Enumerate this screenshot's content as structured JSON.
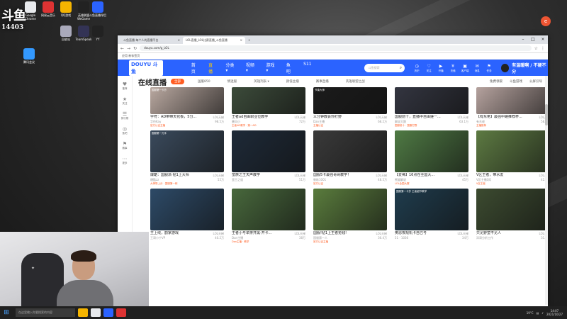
{
  "stream": {
    "logo_top": "斗鱼",
    "room_id": "14403"
  },
  "desktop_icons": [
    {
      "label": "Google Chrome",
      "color": "#e8eaed"
    },
    {
      "label": "网易云音乐",
      "color": "#d33"
    },
    {
      "label": "QQ游戏",
      "color": "#f4b400"
    },
    {
      "label": "英雄联盟 WeGame",
      "color": "#222"
    },
    {
      "label": "斗鱼直播伴侣",
      "color": "#2b63ff"
    },
    {
      "label": "回收站",
      "color": "#aab"
    },
    {
      "label": "TeamSpeak",
      "color": "#335"
    },
    {
      "label": "YY",
      "color": "#222"
    },
    {
      "label": "腾讯会议",
      "color": "#39f"
    }
  ],
  "browser": {
    "tabs": [
      {
        "label": "斗鱼直播-每个人的直播平台",
        "active": false
      },
      {
        "label": "LOL直播_LOL比赛直播_斗鱼直播",
        "active": true
      }
    ],
    "new_tab": "+",
    "url": "douyu.com/g_LOL",
    "bookmarks": "应用  新标签页"
  },
  "douyu": {
    "logo": "DOUYU 斗鱼",
    "nav": [
      {
        "label": "首页",
        "active": false
      },
      {
        "label": "直播",
        "active": true
      },
      {
        "label": "分类 ▾",
        "active": false
      },
      {
        "label": "视频 ▾",
        "active": false
      },
      {
        "label": "游戏 ▾",
        "active": false
      },
      {
        "label": "鱼吧",
        "active": false
      },
      {
        "label": "S11",
        "active": false
      }
    ],
    "search_placeholder": "斗鱼搜索",
    "header_icons": [
      {
        "label": "历史",
        "glyph": "◷"
      },
      {
        "label": "关注",
        "glyph": "♡"
      },
      {
        "label": "开播",
        "glyph": "▶"
      },
      {
        "label": "充值",
        "glyph": "¥"
      },
      {
        "label": "客户端",
        "glyph": "▣"
      },
      {
        "label": "消息",
        "glyph": "✉"
      },
      {
        "label": "任务",
        "glyph": "⚑"
      }
    ],
    "username": "有温暖啊 / 不硬不分",
    "left_rail": [
      {
        "label": "推荐",
        "glyph": "♥"
      },
      {
        "label": "关注",
        "glyph": "★"
      },
      {
        "label": "排行榜",
        "glyph": "☰"
      },
      {
        "label": "鱼吧",
        "glyph": "◎"
      },
      {
        "label": "赛事",
        "glyph": "⚑"
      },
      {
        "label": "更多",
        "glyph": "⋯"
      }
    ],
    "section_title": "在线直播",
    "filters": [
      {
        "label": "全部",
        "active": true
      },
      {
        "label": "国服850",
        "active": false
      },
      {
        "label": "情迷服",
        "active": false
      },
      {
        "label": "英雄列表 ▾",
        "active": false
      },
      {
        "label": "颜值主播",
        "active": false
      },
      {
        "label": "赛事直播",
        "active": false
      },
      {
        "label": "英雄联盟之战",
        "active": false
      }
    ],
    "header_right": [
      "免费领取",
      "斗鱼游戏",
      "公屏引导"
    ],
    "cards": [
      {
        "title": "字符：AD带带天花板，5分...",
        "cat": "LOL天梯",
        "anchor": "字符Kay",
        "hot": "98.5万",
        "badge": "官方认证主播",
        "color": "#b9a8a0",
        "tag": "国服第一卡莎",
        "cut": true
      },
      {
        "title": "王者ad自由职业位教学",
        "cat": "LOL天梯",
        "anchor": "暴风小",
        "hot": "72万",
        "badge": "王者AD教学 · 第一AD",
        "color": "#3c4b3a",
        "tag": "",
        "cut": true
      },
      {
        "title": "三分钟教会你打野",
        "cat": "LOL天梯",
        "anchor": "Dan主播",
        "hot": "68.2万",
        "badge": "主播认证",
        "color": "#1b1b1b",
        "tag": "节奏大师",
        "cut": true
      },
      {
        "title": "国服前十，直播中自由搓一...",
        "cat": "LOL天梯",
        "anchor": "解说大鹅",
        "hot": "63.1万",
        "badge": "国服前十 · 国服打野",
        "color": "#333540",
        "tag": "",
        "cut": true
      },
      {
        "title": "【有东佬】最强中路推荐杯...",
        "cat": "LOL天梯",
        "anchor": "有东佬",
        "hot": "58.6万",
        "badge": "主播推荐",
        "color": "#b5a29e",
        "tag": "",
        "cut": true
      },
      {
        "title": "爆酷：国服派·钻1上大师",
        "cat": "LOL天梯",
        "anchor": "爆酷zz",
        "hot": "55万",
        "badge": "大神带上分 · 国服第一刺",
        "color": "#3a4a5c",
        "tag": "国服第一刀手",
        "cut": false
      },
      {
        "title": "蛮族之王天声教学",
        "cat": "LOL天梯",
        "anchor": "蛮王之道",
        "hot": "51万",
        "badge": "",
        "color": "#1e2a38",
        "tag": "",
        "cut": false
      },
      {
        "title": "国服5卡最强哥哥教学！",
        "cat": "LOL天梯",
        "anchor": "教练1001",
        "hot": "48.5万",
        "badge": "官方认证",
        "color": "#3a3a3a",
        "tag": "",
        "cut": false
      },
      {
        "title": "【爱稀】16点在全国大...",
        "cat": "LOL天梯",
        "anchor": "熊猫解说",
        "hot": "45万",
        "badge": "LOL全国大赛",
        "color": "#4f7a44",
        "tag": "",
        "cut": false
      },
      {
        "title": "V区王者，带水友",
        "cat": "LOL天梯",
        "anchor": "V区主播QQ",
        "hot": "42.5万",
        "badge": "V区王者",
        "color": "#5d7a42",
        "tag": "",
        "cut": false
      },
      {
        "title": "王上线，韵家游戏",
        "cat": "LOL天梯",
        "anchor": "王哥小宁VP",
        "hot": "40.2万",
        "badge": "",
        "color": "#2d4a67",
        "tag": "",
        "cut": false
      },
      {
        "title": "王者小号单排开黑·开卡...",
        "cat": "LOL天梯",
        "anchor": "Dan主播",
        "hot": "38万",
        "badge": "Dan主播 · 教学",
        "color": "#48683c",
        "tag": "",
        "cut": false
      },
      {
        "title": "国服!钻1上王者抢钱!",
        "cat": "LOL天梯",
        "anchor": "国服第一人",
        "hot": "36.4万",
        "badge": "官方认证主播",
        "color": "#5a7c3d",
        "tag": "",
        "cut": false
      },
      {
        "title": "奥恩夜观机卡自己号",
        "cat": "LOL天梯",
        "anchor": "51 · 1036",
        "hot": "34万",
        "badge": "",
        "color": "#1f3c4d",
        "tag": "国服第一卡莎 王者细节教学",
        "cut": false
      },
      {
        "title": "只见野蛮不见人",
        "cat": "LOL天梯",
        "anchor": "邓哥分析工作",
        "hot": "31.8万",
        "badge": "",
        "color": "#3c4b30",
        "tag": "",
        "cut": false
      }
    ]
  },
  "taskbar": {
    "search_placeholder": "在这里输入你要搜索的内容",
    "tray_weather": "19°C",
    "time": "14:07",
    "date": "2021/10/27"
  }
}
